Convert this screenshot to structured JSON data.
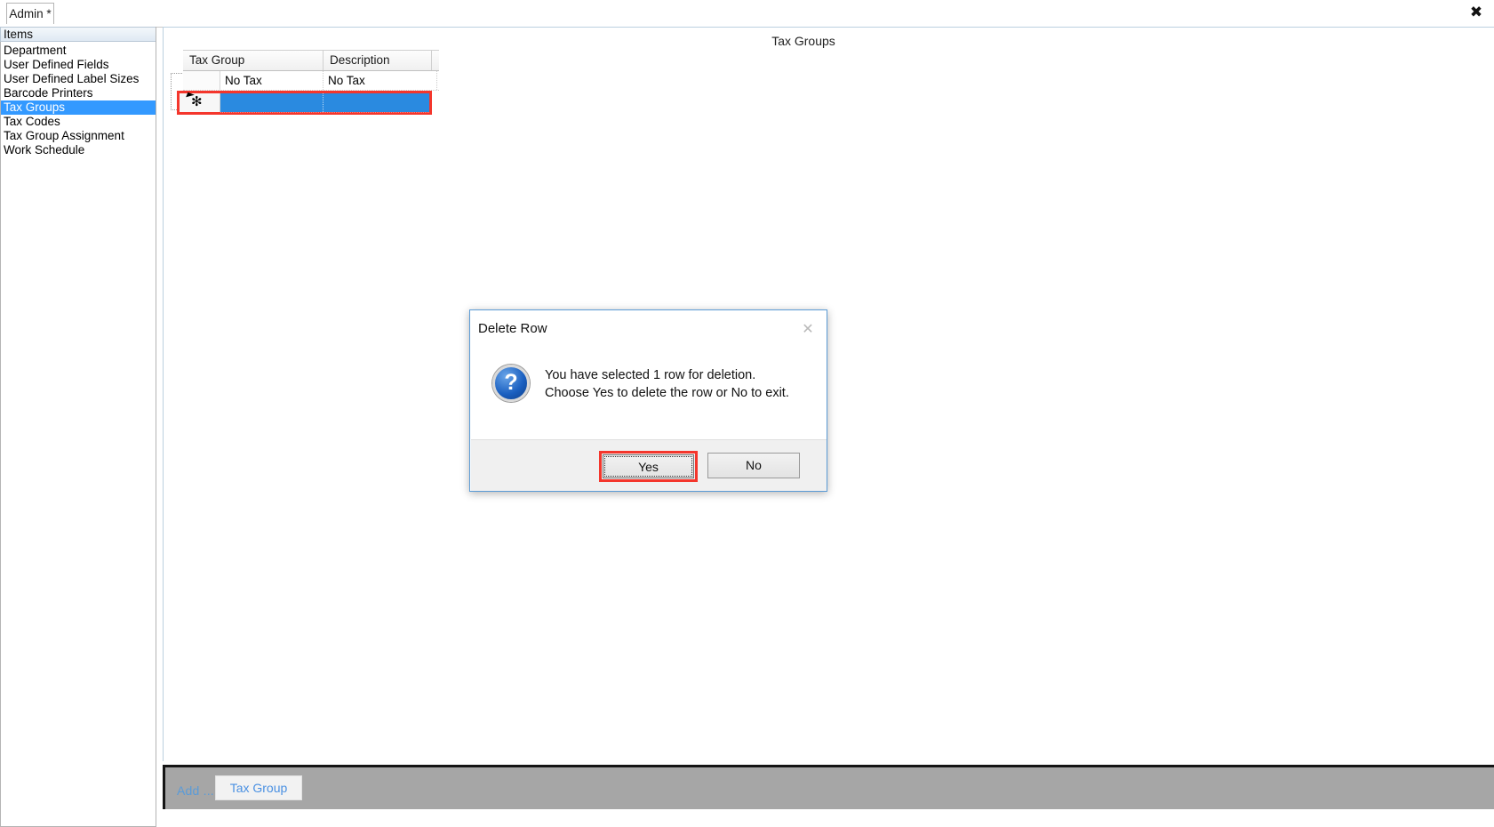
{
  "window": {
    "tab_label": "Admin *",
    "close_icon": "close-icon",
    "close_glyph": "✖"
  },
  "sidebar": {
    "header": "Items",
    "items": [
      {
        "label": "Department",
        "selected": false
      },
      {
        "label": "User Defined Fields",
        "selected": false
      },
      {
        "label": "User Defined Label Sizes",
        "selected": false
      },
      {
        "label": "Barcode Printers",
        "selected": false
      },
      {
        "label": "Tax Groups",
        "selected": true
      },
      {
        "label": "Tax Codes",
        "selected": false
      },
      {
        "label": "Tax Group Assignment",
        "selected": false
      },
      {
        "label": "Work Schedule",
        "selected": false
      }
    ]
  },
  "content": {
    "title": "Tax Groups",
    "grid": {
      "columns": [
        "Tax Group",
        "Description"
      ],
      "rows": [
        {
          "tax_group": "No Tax",
          "description": "No Tax"
        }
      ],
      "new_row": {
        "marker_glyph": "✻",
        "tax_group": "",
        "description": "",
        "selected": true,
        "highlight_color": "#f4362c"
      }
    }
  },
  "bottom_bar": {
    "add_label": "Add ...",
    "tax_group_button": "Tax Group",
    "background_color": "#a6a6a6",
    "link_color": "#5a9bd8"
  },
  "dialog": {
    "title": "Delete Row",
    "close_glyph": "✕",
    "icon": "question-icon",
    "icon_glyph": "?",
    "message_line_1": "You have selected 1 row for deletion.",
    "message_line_2": "Choose Yes to delete the row or No to exit.",
    "buttons": {
      "yes": "Yes",
      "no": "No"
    },
    "highlight_color": "#f4362c"
  }
}
